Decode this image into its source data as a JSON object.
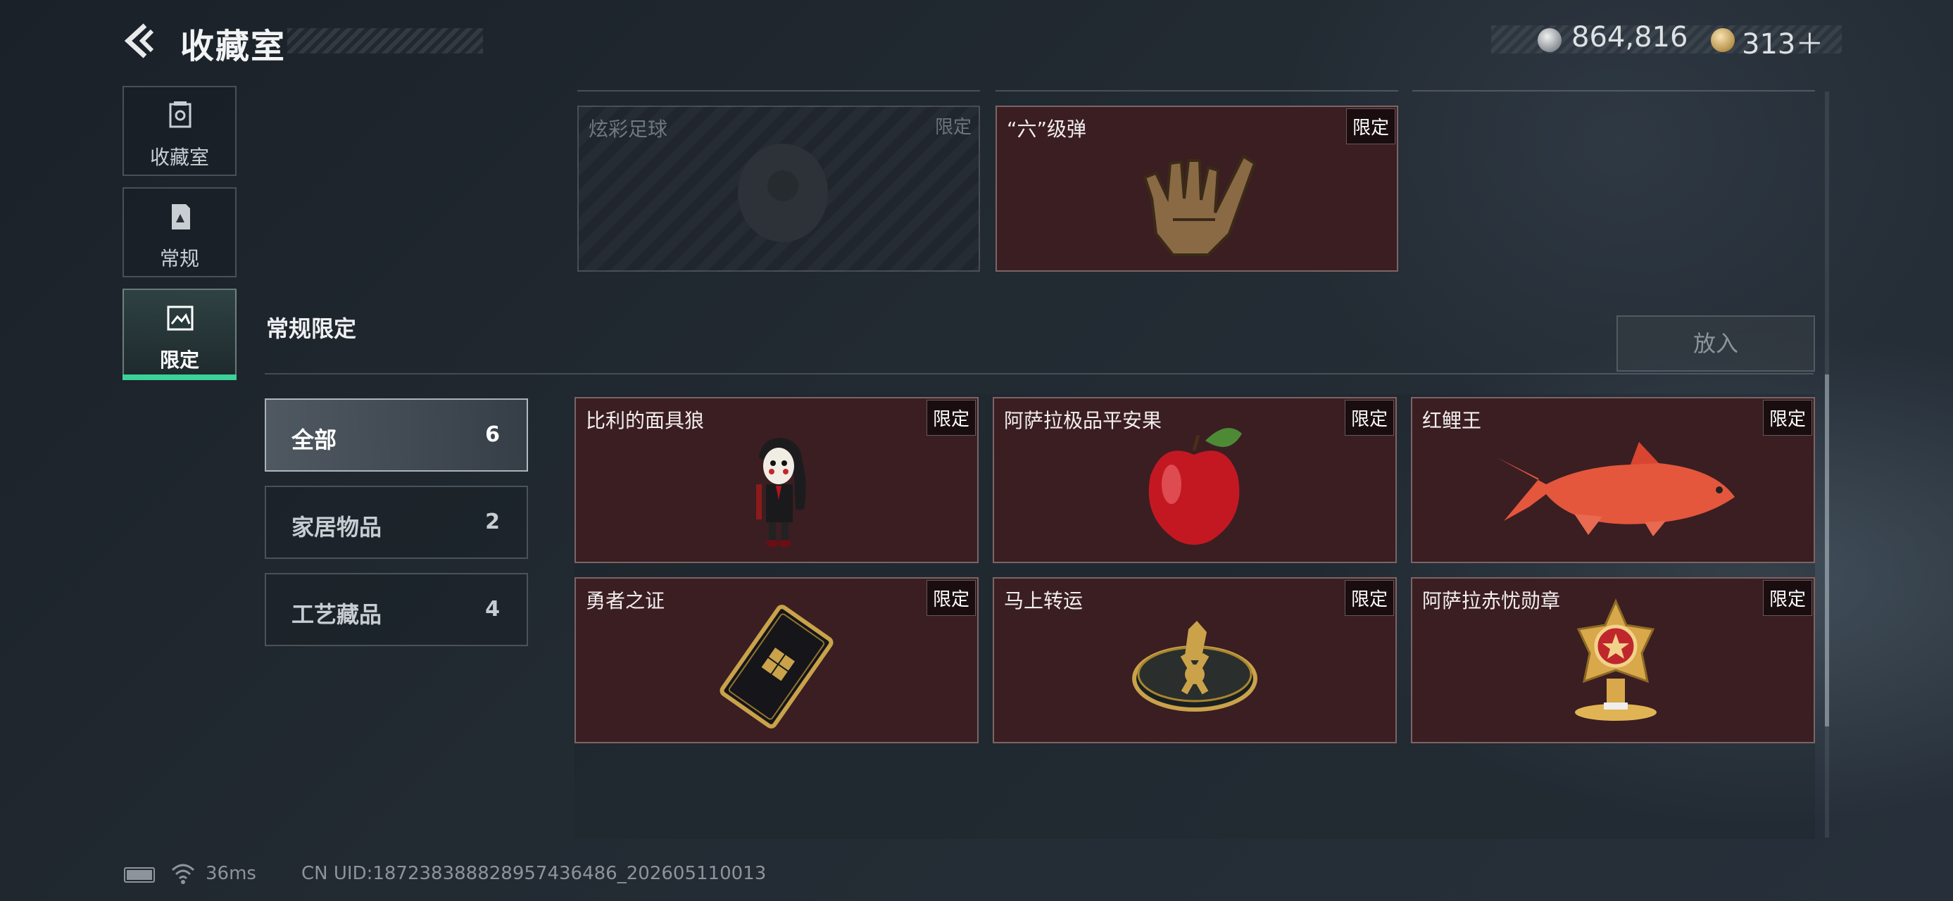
{
  "header": {
    "title": "收藏室",
    "currency": {
      "silver_amount": "864,816",
      "gold_amount": "313＋"
    }
  },
  "nav": {
    "items": [
      {
        "label": "收藏室",
        "icon": "collection-room-icon"
      },
      {
        "label": "常规",
        "icon": "regular-doc-icon"
      },
      {
        "label": "限定",
        "icon": "limited-frame-icon",
        "active": true
      }
    ]
  },
  "top_row": [
    {
      "name": "炫彩足球",
      "badge": "限定",
      "locked": true
    },
    {
      "name": "“六”级弹",
      "badge": "限定",
      "locked": false
    }
  ],
  "section": {
    "title": "常规限定",
    "put_in_label": "放入"
  },
  "filters": [
    {
      "label": "全部",
      "count": "6",
      "selected": true
    },
    {
      "label": "家居物品",
      "count": "2",
      "selected": false
    },
    {
      "label": "工艺藏品",
      "count": "4",
      "selected": false
    }
  ],
  "items": [
    {
      "name": "比利的面具狼",
      "badge": "限定"
    },
    {
      "name": "阿萨拉极品平安果",
      "badge": "限定"
    },
    {
      "name": "红鲤王",
      "badge": "限定"
    },
    {
      "name": "勇者之证",
      "badge": "限定"
    },
    {
      "name": "马上转运",
      "badge": "限定"
    },
    {
      "name": "阿萨拉赤忧勋章",
      "badge": "限定"
    }
  ],
  "status": {
    "ping": "36ms",
    "uid": "CN UID:18723838882895​7436486_202605110013"
  },
  "colors": {
    "accent": "#3bd39a",
    "card_bg": "#3a1e22"
  }
}
